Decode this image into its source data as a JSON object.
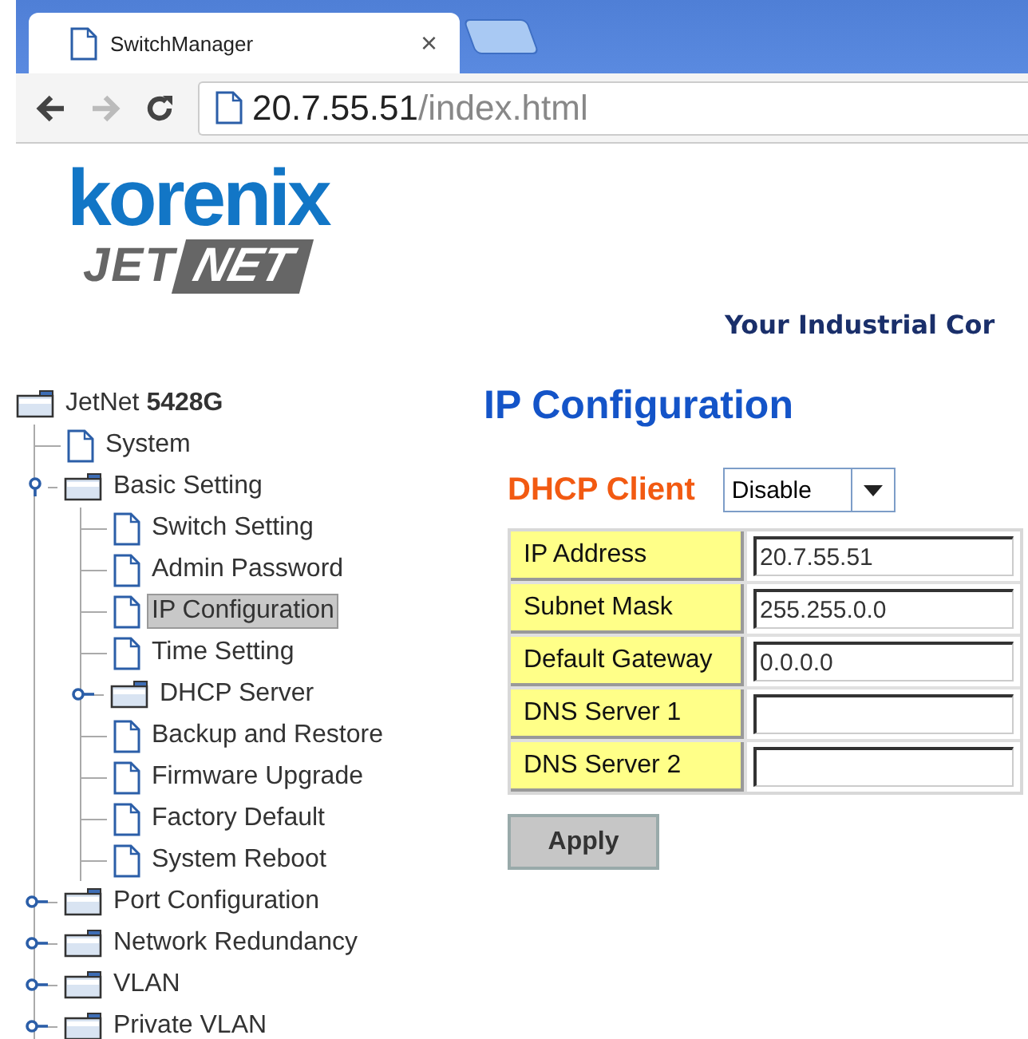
{
  "browser": {
    "tab_title": "SwitchManager",
    "close": "×",
    "url_host": "20.7.55.51",
    "url_path": "/index.html"
  },
  "logo": {
    "brand": "korenix",
    "line_1": "JET",
    "line_2": "NET"
  },
  "tagline": "Your Industrial Cor",
  "tree": {
    "label": "JetNet **5428G**",
    "children": [
      {
        "label": "System",
        "kind": "page",
        "selected": false
      },
      {
        "label": "Basic Setting",
        "kind": "folder",
        "expanded": true,
        "children": [
          {
            "label": "Switch Setting",
            "kind": "page",
            "selected": false
          },
          {
            "label": "Admin Password",
            "kind": "page",
            "selected": false
          },
          {
            "label": "IP Configuration",
            "kind": "page",
            "selected": true
          },
          {
            "label": "Time Setting",
            "kind": "page",
            "selected": false
          },
          {
            "label": "DHCP Server",
            "kind": "folder",
            "expanded": false
          },
          {
            "label": "Backup and Restore",
            "kind": "page",
            "selected": false
          },
          {
            "label": "Firmware Upgrade",
            "kind": "page",
            "selected": false
          },
          {
            "label": "Factory Default",
            "kind": "page",
            "selected": false
          },
          {
            "label": "System Reboot",
            "kind": "page",
            "selected": false
          }
        ]
      },
      {
        "label": "Port Configuration",
        "kind": "folder",
        "expanded": false
      },
      {
        "label": "Network Redundancy",
        "kind": "folder",
        "expanded": false
      },
      {
        "label": "VLAN",
        "kind": "folder",
        "expanded": false
      },
      {
        "label": "Private VLAN",
        "kind": "folder",
        "expanded": false
      }
    ]
  },
  "page_title": "IP Configuration",
  "dhcp_client": {
    "label": "DHCP Client",
    "value": "Disable"
  },
  "fields": [
    {
      "label": "IP Address",
      "value": "20.7.55.51"
    },
    {
      "label": "Subnet Mask",
      "value": "255.255.0.0"
    },
    {
      "label": "Default Gateway",
      "value": "0.0.0.0"
    },
    {
      "label": "DNS Server 1"
    },
    {
      "label": "DNS Server 2"
    }
  ],
  "apply_button": "Apply"
}
